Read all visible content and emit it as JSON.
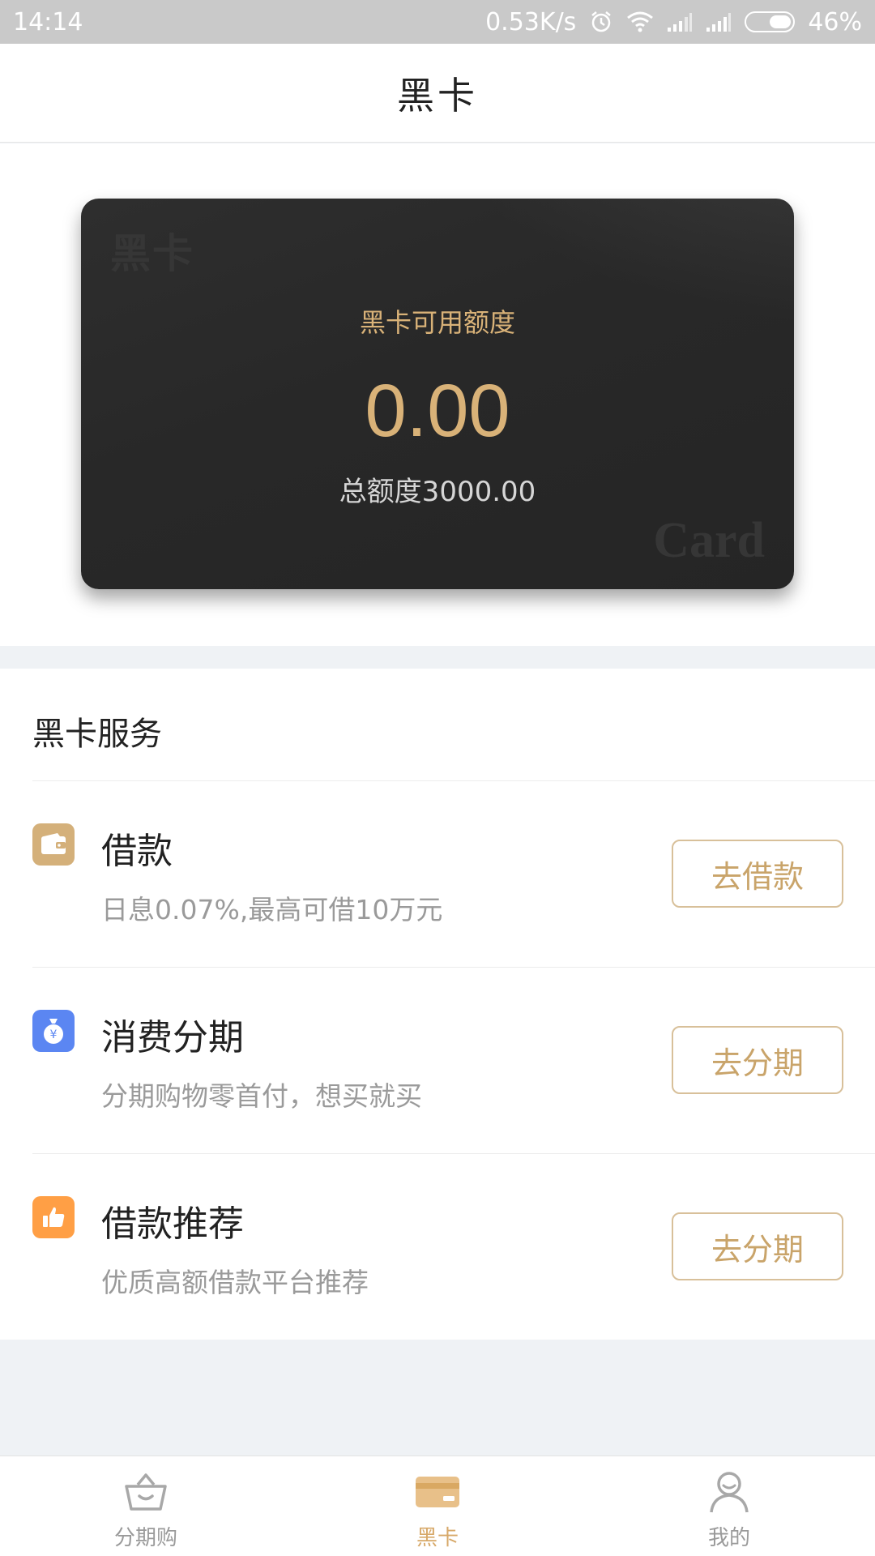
{
  "status_bar": {
    "time": "14:14",
    "speed": "0.53K/s",
    "battery": "46%",
    "icons": [
      "alarm-icon",
      "wifi-icon",
      "signal-icon",
      "signal-icon",
      "battery-icon"
    ]
  },
  "nav": {
    "title": "黑卡"
  },
  "card": {
    "watermark_top": "黑卡",
    "label": "黑卡可用额度",
    "amount": "0.00",
    "total": "总额度3000.00",
    "watermark_bottom": "Card",
    "colors": {
      "gold": "#d9b278",
      "background": "#282828"
    }
  },
  "services": {
    "title": "黑卡服务",
    "items": [
      {
        "name": "借款",
        "desc": "日息0.07%,最高可借10万元",
        "button": "去借款",
        "icon": "wallet-icon",
        "icon_color": "#d4b07a"
      },
      {
        "name": "消费分期",
        "desc": "分期购物零首付，想买就买",
        "button": "去分期",
        "icon": "money-bag-icon",
        "icon_color": "#5b86f2"
      },
      {
        "name": "借款推荐",
        "desc": "优质高额借款平台推荐",
        "button": "去分期",
        "icon": "thumbs-up-icon",
        "icon_color": "#ff9f45"
      }
    ]
  },
  "tabs": [
    {
      "label": "分期购",
      "icon": "basket-icon",
      "active": false
    },
    {
      "label": "黑卡",
      "icon": "card-icon",
      "active": true
    },
    {
      "label": "我的",
      "icon": "user-icon",
      "active": false
    }
  ],
  "colors": {
    "accent": "#d7a868",
    "button_border": "#d8c09a",
    "button_text": "#c9a46a"
  }
}
